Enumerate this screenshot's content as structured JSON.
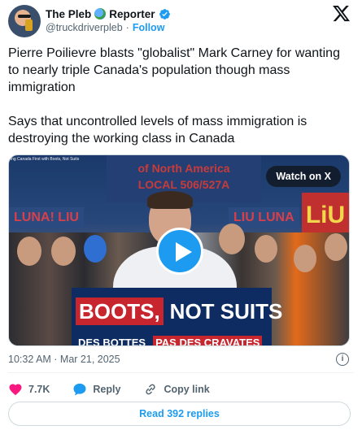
{
  "author": {
    "name": "The Pleb",
    "name_suffix": "Reporter",
    "handle": "@truckdriverpleb",
    "separator": "·",
    "follow_label": "Follow"
  },
  "tweet": {
    "text": "Pierre Poilievre blasts \"globalist\" Mark Carney for wanting to nearly triple Canada's population though mass immigration\n\nSays that uncontrolled levels of mass immigration is destroying the working class in Canada"
  },
  "media": {
    "caption_strip": "ing Canada First with Boots, Not Suits",
    "banner_text": "of North America\nLOCAL 506/527A",
    "luna_left": "LUNA! LIU",
    "luna_right": "LIU LUNA",
    "liu_sign": "LiU",
    "sign_part1": "BOOTS,",
    "sign_part2": "NOT SUITS",
    "sign_sub1": "DES BOTTES",
    "sign_sub2": "PAS DES CRAVATES",
    "watch_label": "Watch on X"
  },
  "meta": {
    "timestamp": "10:32 AM · Mar 21, 2025"
  },
  "actions": {
    "likes": "7.7K",
    "reply_label": "Reply",
    "copy_label": "Copy link"
  },
  "replies_button": "Read 392 replies",
  "colors": {
    "accent": "#1d9bf0",
    "like": "#f91880",
    "text": "#0f1419",
    "muted": "#536471"
  }
}
